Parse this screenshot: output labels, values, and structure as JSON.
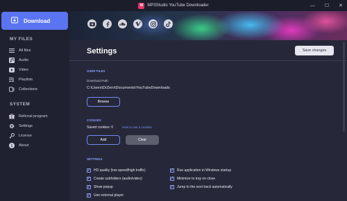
{
  "window": {
    "logo_text": "M",
    "title": "MP3Studio YouTube Downloader",
    "controls": [
      "—",
      "☐",
      "✕"
    ]
  },
  "sidebar": {
    "download_label": "Download",
    "my_files_title": "MY FILES",
    "my_files": [
      {
        "label": "All files",
        "icon": "list-icon"
      },
      {
        "label": "Audio",
        "icon": "music-icon"
      },
      {
        "label": "Video",
        "icon": "video-icon"
      },
      {
        "label": "Playlists",
        "icon": "playlist-icon"
      },
      {
        "label": "Collections",
        "icon": "collections-icon"
      }
    ],
    "system_title": "SYSTEM",
    "system": [
      {
        "label": "Referral program",
        "icon": "gift-icon"
      },
      {
        "label": "Settings",
        "icon": "gear-icon"
      },
      {
        "label": "License",
        "icon": "key-icon"
      },
      {
        "label": "About",
        "icon": "info-icon"
      }
    ]
  },
  "banner": {
    "socials": [
      "youtube-icon",
      "facebook-icon",
      "soundcloud-icon",
      "vimeo-icon",
      "instagram-icon",
      "tiktok-icon"
    ]
  },
  "main": {
    "title": "Settings",
    "save_label": "Save changes",
    "user_files": {
      "title": "USER FILES",
      "download_path_label": "Download Path:",
      "download_path": "C:\\Users\\DrZero\\Documents\\YouTubeDownloads",
      "browse_label": "Browse"
    },
    "cookies": {
      "title": "COOKIES",
      "saved_label": "Saved cookies: 0",
      "howto_link": "How to use a cookies",
      "add_label": "Add",
      "clear_label": "Clear"
    },
    "settings": {
      "title": "SETTINGS",
      "check_mark": "✓",
      "left": [
        {
          "label": "HD quality (low speed/high traffic)",
          "checked": true
        },
        {
          "label": "Create subfolders (audio/video)",
          "checked": true
        },
        {
          "label": "Show popup",
          "checked": true
        },
        {
          "label": "Use external player",
          "checked": true
        }
      ],
      "right": [
        {
          "label": "Run application in Windows startup",
          "checked": true
        },
        {
          "label": "Minimize to tray on close",
          "checked": true
        },
        {
          "label": "Jump to the next track automatically",
          "checked": true
        }
      ]
    }
  },
  "colors": {
    "accent": "#5a74f2",
    "sidebar_bg": "#1f2030",
    "main_bg": "#262839",
    "titlebar_bg": "#1c1d2b"
  }
}
